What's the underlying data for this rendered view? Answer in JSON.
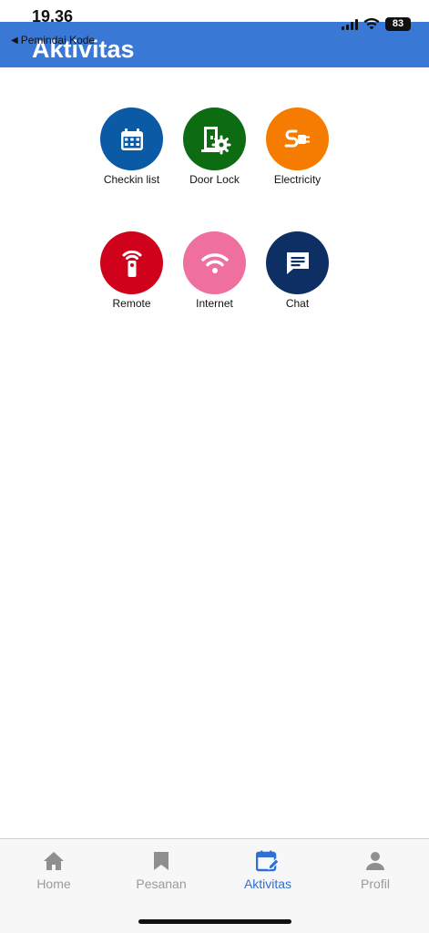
{
  "status_bar": {
    "time": "19.36",
    "battery": "83"
  },
  "header": {
    "back_label": "Pemindai Kode",
    "title": "Aktivitas",
    "color": "#3a78d6"
  },
  "activities": [
    {
      "label": "Checkin list",
      "icon": "calendar-icon",
      "color": "#0b5aa6"
    },
    {
      "label": "Door Lock",
      "icon": "door-lock-icon",
      "color": "#0d6b12"
    },
    {
      "label": "Electricity",
      "icon": "plug-icon",
      "color": "#f57c00"
    },
    {
      "label": "Remote",
      "icon": "remote-icon",
      "color": "#d0021b"
    },
    {
      "label": "Internet",
      "icon": "wifi-icon",
      "color": "#ef6f9f"
    },
    {
      "label": "Chat",
      "icon": "chat-icon",
      "color": "#0e2f63"
    }
  ],
  "bottom_nav": {
    "active": "Aktivitas",
    "active_color": "#2f6fd6",
    "inactive_color": "#9a9a9a",
    "items": [
      {
        "label": "Home",
        "icon": "home-icon"
      },
      {
        "label": "Pesanan",
        "icon": "bookmark-icon"
      },
      {
        "label": "Aktivitas",
        "icon": "calendar-edit-icon"
      },
      {
        "label": "Profil",
        "icon": "person-icon"
      }
    ]
  }
}
